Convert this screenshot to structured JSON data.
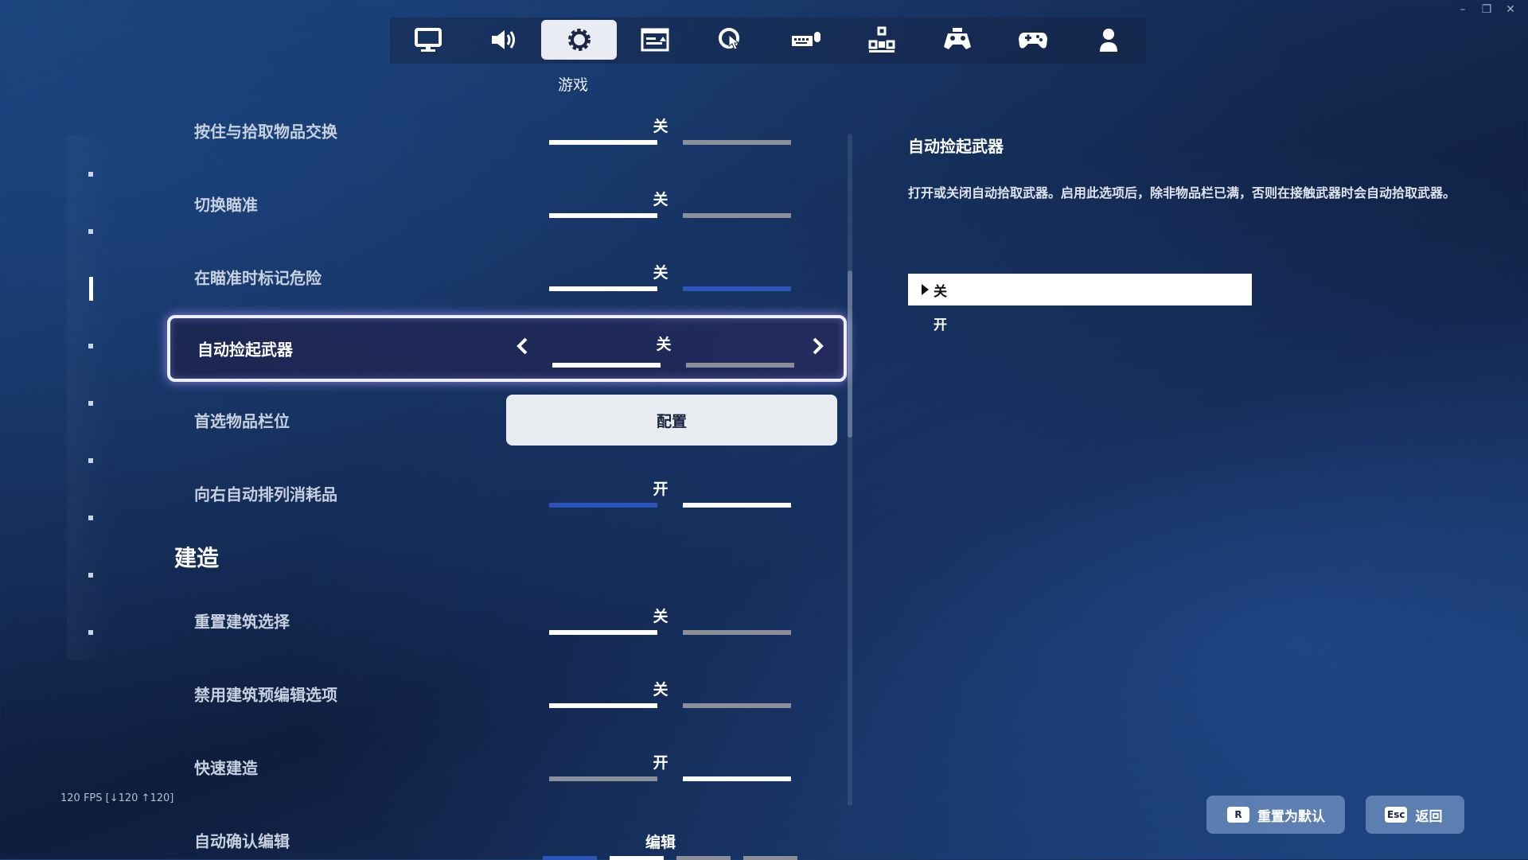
{
  "tabs": [
    {
      "icon": "monitor-icon"
    },
    {
      "icon": "speaker-icon"
    },
    {
      "icon": "gear-icon",
      "active": true
    },
    {
      "icon": "subtitles-icon"
    },
    {
      "icon": "touch-icon"
    },
    {
      "icon": "keyboard-mouse-icon"
    },
    {
      "icon": "controller-buttons-icon"
    },
    {
      "icon": "gamepad-alt-icon"
    },
    {
      "icon": "gamepad-icon"
    },
    {
      "icon": "account-icon"
    }
  ],
  "active_tab_caption": "游戏",
  "settings": {
    "swap_pickup": {
      "label": "按住与拾取物品交换",
      "value": "关"
    },
    "toggle_aim": {
      "label": "切换瞄准",
      "value": "关"
    },
    "mark_danger": {
      "label": "在瞄准时标记危险",
      "value": "关"
    },
    "auto_pickup_weapons": {
      "label": "自动捡起武器",
      "value": "关"
    },
    "preferred_slot": {
      "label": "首选物品栏位",
      "button": "配置"
    },
    "auto_sort_right": {
      "label": "向右自动排列消耗品",
      "value": "开"
    },
    "section_build": "建造",
    "reset_building": {
      "label": "重置建筑选择",
      "value": "关"
    },
    "disable_preedit": {
      "label": "禁用建筑预编辑选项",
      "value": "关"
    },
    "turbo_build": {
      "label": "快速建造",
      "value": "开"
    },
    "auto_confirm_edit": {
      "label": "自动确认编辑",
      "value": "编辑"
    }
  },
  "detail": {
    "title": "自动捡起武器",
    "description": "打开或关闭自动拾取武器。启用此选项后，除非物品栏已满，否则在接触武器时会自动拾取武器。",
    "options": [
      "关",
      "开"
    ],
    "selected_index": 0
  },
  "fps": "120 FPS [↓120 ↑120]",
  "footer": {
    "reset_key": "R",
    "reset_label": "重置为默认",
    "back_key": "Esc",
    "back_label": "返回"
  },
  "colors": {
    "on_bar": "#ffffff",
    "off_bar": "#8a8f99",
    "accent_blue": "#2b55b8"
  }
}
